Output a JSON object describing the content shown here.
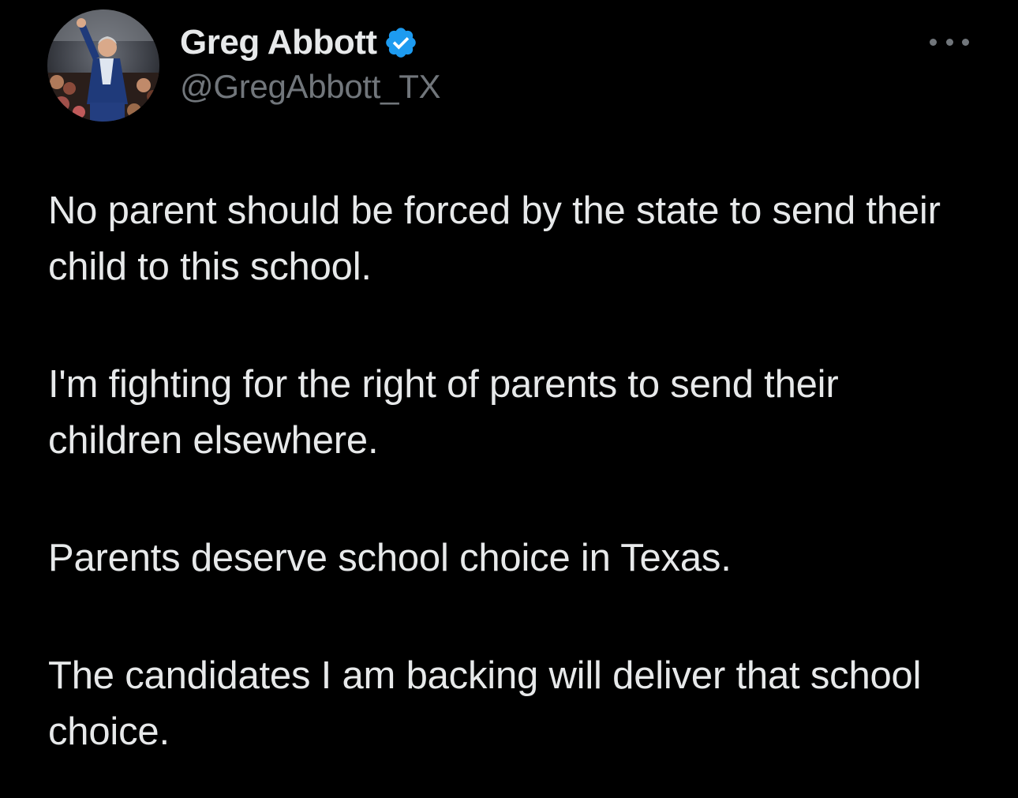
{
  "tweet": {
    "author": {
      "display_name": "Greg Abbott",
      "handle": "@GregAbbott_TX",
      "verified_icon": "verified-badge-icon",
      "avatar_icon": "avatar-photo"
    },
    "more_icon": "more-options-icon",
    "paragraphs": [
      "No parent should be forced by the state to send their child to this school.",
      "I'm fighting for the right of parents to send their children elsewhere.",
      "Parents deserve school choice in Texas.",
      "The candidates I am backing will deliver that school choice."
    ]
  },
  "colors": {
    "background": "#000000",
    "text_primary": "#e7e9ea",
    "text_secondary": "#71767b",
    "verified_blue": "#1d9bf0"
  }
}
